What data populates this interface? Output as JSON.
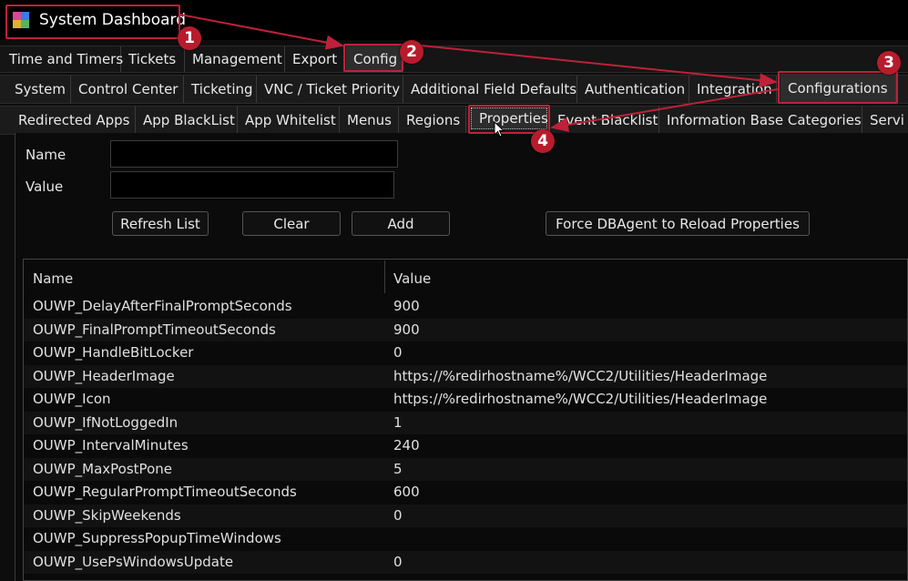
{
  "window": {
    "title": "System Dashboard",
    "app_icon": "app-cube-icon"
  },
  "menu_tabs": [
    {
      "label": "Time and Timers"
    },
    {
      "label": "Tickets"
    },
    {
      "label": "Management"
    },
    {
      "label": "Export"
    },
    {
      "label": "Config"
    }
  ],
  "config_tabs": [
    {
      "label": "System"
    },
    {
      "label": "Control Center"
    },
    {
      "label": "Ticketing"
    },
    {
      "label": "VNC / Ticket Priority"
    },
    {
      "label": "Additional Field Defaults"
    },
    {
      "label": "Authentication"
    },
    {
      "label": "Integration"
    },
    {
      "label": "Configurations"
    }
  ],
  "sub_tabs": [
    {
      "label": "Redirected Apps"
    },
    {
      "label": "App BlackList"
    },
    {
      "label": "App Whitelist"
    },
    {
      "label": "Menus"
    },
    {
      "label": "Regions"
    },
    {
      "label": "Properties"
    },
    {
      "label": "Event Blacklist"
    },
    {
      "label": "Information Base Categories"
    },
    {
      "label": "Servi"
    }
  ],
  "form": {
    "name_label": "Name",
    "value_label": "Value",
    "name_value": "",
    "value_value": "",
    "buttons": {
      "refresh": "Refresh List",
      "clear": "Clear",
      "add": "Add",
      "force_reload": "Force DBAgent to Reload Properties"
    }
  },
  "grid": {
    "columns": [
      "Name",
      "Value"
    ],
    "rows": [
      {
        "name": "OUWP_DelayAfterFinalPromptSeconds",
        "value": "900"
      },
      {
        "name": "OUWP_FinalPromptTimeoutSeconds",
        "value": "900"
      },
      {
        "name": "OUWP_HandleBitLocker",
        "value": "0"
      },
      {
        "name": "OUWP_HeaderImage",
        "value": "https://%redirhostname%/WCC2/Utilities/HeaderImage"
      },
      {
        "name": "OUWP_Icon",
        "value": "https://%redirhostname%/WCC2/Utilities/HeaderImage"
      },
      {
        "name": "OUWP_IfNotLoggedIn",
        "value": "1"
      },
      {
        "name": "OUWP_IntervalMinutes",
        "value": "240"
      },
      {
        "name": "OUWP_MaxPostPone",
        "value": "5"
      },
      {
        "name": "OUWP_RegularPromptTimeoutSeconds",
        "value": "600"
      },
      {
        "name": "OUWP_SkipWeekends",
        "value": "0"
      },
      {
        "name": "OUWP_SuppressPopupTimeWindows",
        "value": ""
      },
      {
        "name": "OUWP_UsePsWindowsUpdate",
        "value": "0"
      }
    ]
  },
  "annotations": {
    "color": "#c0203a",
    "steps": [
      "1",
      "2",
      "3",
      "4"
    ]
  }
}
